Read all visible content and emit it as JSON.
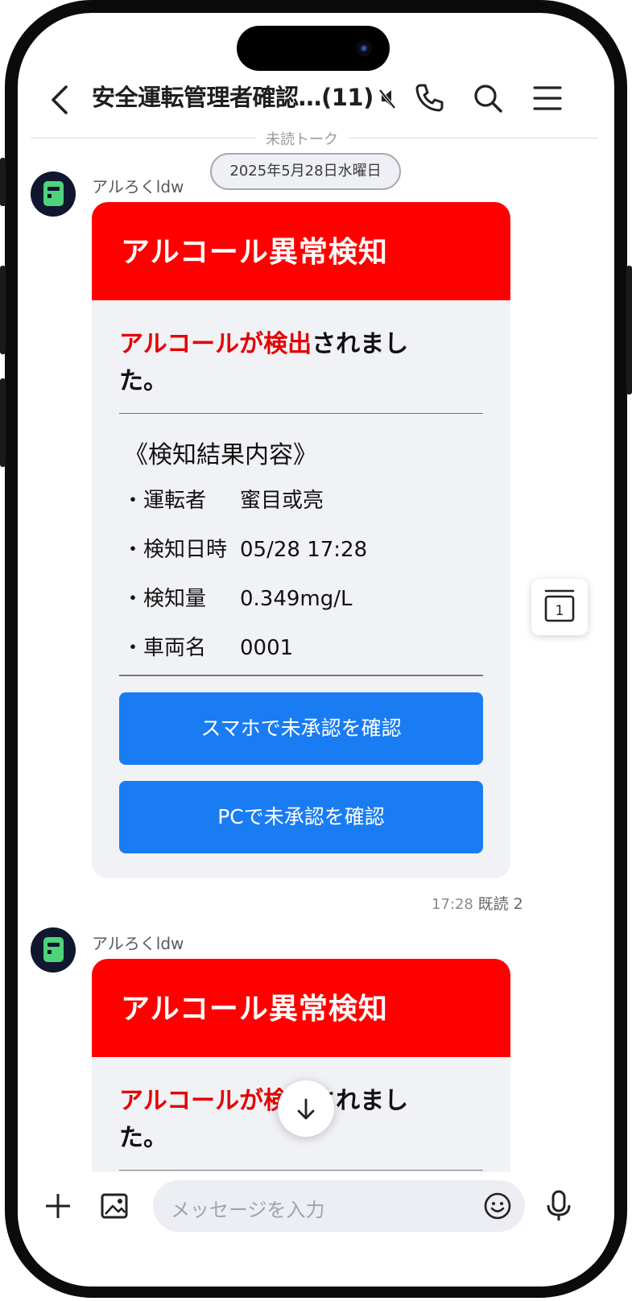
{
  "header": {
    "title": "安全運転管理者確認…(11)",
    "icons": [
      "back-arrow-icon",
      "muted-icon",
      "phone-icon",
      "search-icon",
      "menu-icon"
    ]
  },
  "chat": {
    "unread_label": "未読トーク",
    "date_label": "2025年5月28日水曜日",
    "messages": [
      {
        "sender": "アルろくldw",
        "card_title": "アルコール異常検知",
        "lead_red": "アルコールが検出",
        "lead_black_1": "されまし",
        "lead_black_2": "た。",
        "section_title": "《検知結果内容》",
        "rows": [
          {
            "key": "・運転者",
            "value": "蜜目或亮"
          },
          {
            "key": "・検知日時",
            "value": "05/28 17:28"
          },
          {
            "key": "・検知量",
            "value": "0.349mg/L"
          },
          {
            "key": "・車両名",
            "value": "0001"
          }
        ],
        "buttons": [
          "スマホで未承認を確認",
          "PCで未承認を確認"
        ],
        "time": "17:28",
        "read": "既読 2"
      },
      {
        "sender": "アルろくldw",
        "card_title": "アルコール異常検知",
        "lead_red": "アルコールが検出",
        "lead_black_1": "されまし",
        "lead_black_2": "た。"
      }
    ]
  },
  "floating": {
    "page_badge": "1"
  },
  "footer": {
    "input_placeholder": "メッセージを入力"
  },
  "colors": {
    "alert_red": "#ff0000",
    "lead_red": "#e60000",
    "button_blue": "#1a7cf2",
    "card_bg": "#f1f2f6"
  }
}
